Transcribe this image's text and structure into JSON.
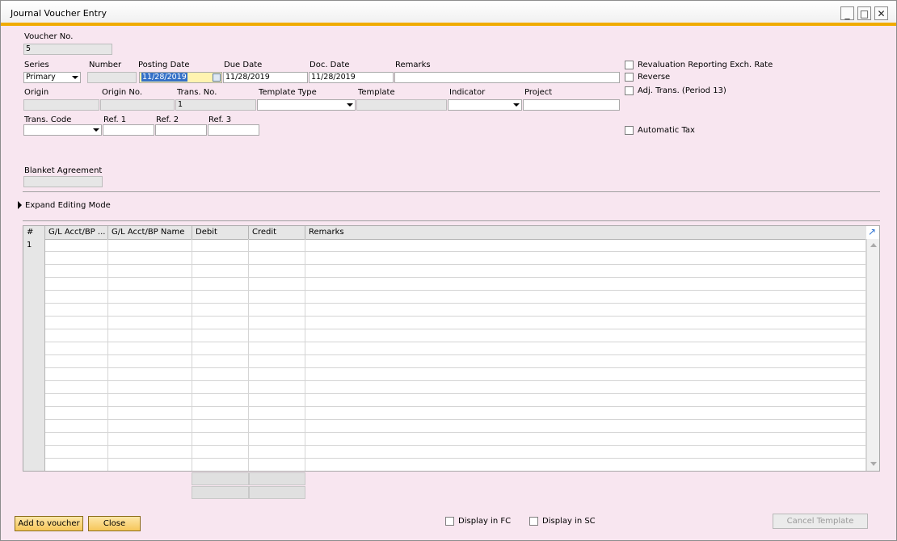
{
  "window": {
    "title": "Journal Voucher Entry",
    "minimize": "_",
    "maximize": "□",
    "close": "✕"
  },
  "header": {
    "voucher_no_label": "Voucher No.",
    "voucher_no_value": "5",
    "series_label": "Series",
    "series_value": "Primary",
    "number_label": "Number",
    "number_value": "",
    "posting_date_label": "Posting Date",
    "posting_date_value": "11/28/2019",
    "due_date_label": "Due Date",
    "due_date_value": "11/28/2019",
    "doc_date_label": "Doc. Date",
    "doc_date_value": "11/28/2019",
    "remarks_label": "Remarks",
    "remarks_value": "",
    "origin_label": "Origin",
    "origin_value": "",
    "origin_no_label": "Origin No.",
    "origin_no_value": "",
    "trans_no_label": "Trans. No.",
    "trans_no_value": "1",
    "template_type_label": "Template Type",
    "template_type_value": "",
    "template_label": "Template",
    "template_value": "",
    "indicator_label": "Indicator",
    "indicator_value": "",
    "project_label": "Project",
    "project_value": "",
    "trans_code_label": "Trans. Code",
    "trans_code_value": "",
    "ref1_label": "Ref. 1",
    "ref1_value": "",
    "ref2_label": "Ref. 2",
    "ref2_value": "",
    "ref3_label": "Ref. 3",
    "ref3_value": "",
    "blanket_label": "Blanket Agreement",
    "blanket_value": ""
  },
  "options": {
    "revaluation_label": "Revaluation Reporting Exch. Rate",
    "reverse_label": "Reverse",
    "adj_trans_label": "Adj. Trans. (Period 13)",
    "automatic_tax_label": "Automatic Tax"
  },
  "expand_label": "Expand Editing Mode",
  "grid": {
    "columns": [
      "#",
      "G/L Acct/BP ...",
      "G/L Acct/BP Name",
      "Debit",
      "Credit",
      "Remarks"
    ],
    "first_row_number": "1"
  },
  "footer": {
    "add_label": "Add to voucher",
    "close_label": "Close",
    "display_fc_label": "Display in FC",
    "display_sc_label": "Display in SC",
    "cancel_template_label": "Cancel Template"
  },
  "colors": {
    "accent": "#f0ab00",
    "background": "#f8e6f0",
    "button": "#f6c65a"
  }
}
